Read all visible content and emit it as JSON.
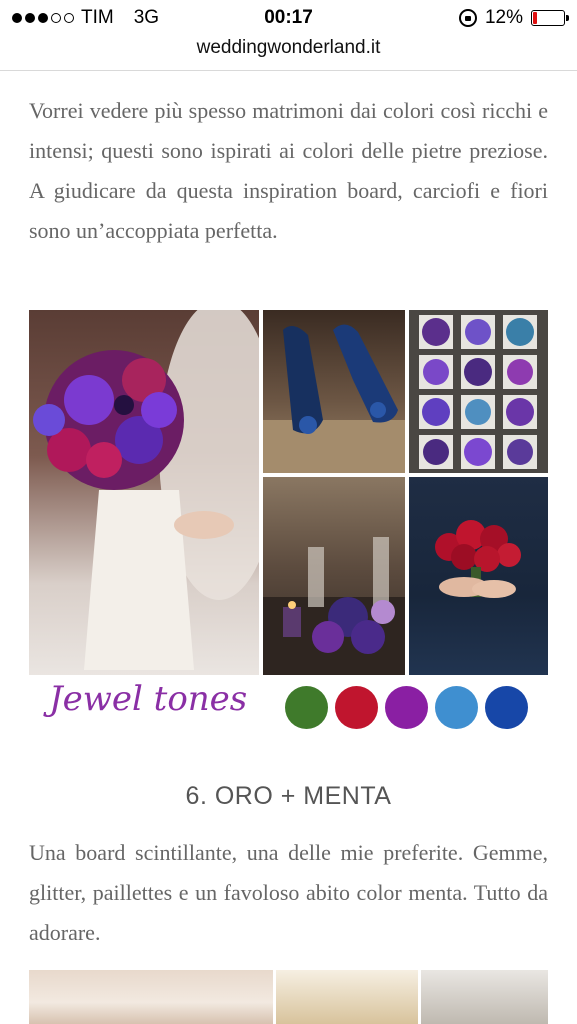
{
  "status_bar": {
    "carrier": "TIM",
    "network": "3G",
    "time": "00:17",
    "battery": "12%",
    "battery_level": 0.12,
    "signal_bars_filled": 3,
    "signal_bars_total": 5
  },
  "browser": {
    "url": "weddingwonderland.it"
  },
  "article": {
    "paragraph_1": "Vorrei vedere più spesso matrimoni dai colori così ricchi e intensi; questi sono ispirati ai colori delle pietre preziose. A giudicare da questa inspiration board, carciofi e fiori sono un’accoppiata perfetta.",
    "board_1": {
      "caption": "Jewel tones",
      "swatches": [
        "#3f7a2b",
        "#c0152e",
        "#8a1fa3",
        "#3f8fd0",
        "#1747a8"
      ]
    },
    "section_heading": "6. ORO + MENTA",
    "paragraph_2": "Una board scintillante, una delle mie preferite. Gemme, glitter, paillettes e un favoloso abito color menta. Tutto da adorare."
  },
  "colors": {
    "text": "#666666",
    "heading": "#555555",
    "battery_low": "#e01010"
  }
}
